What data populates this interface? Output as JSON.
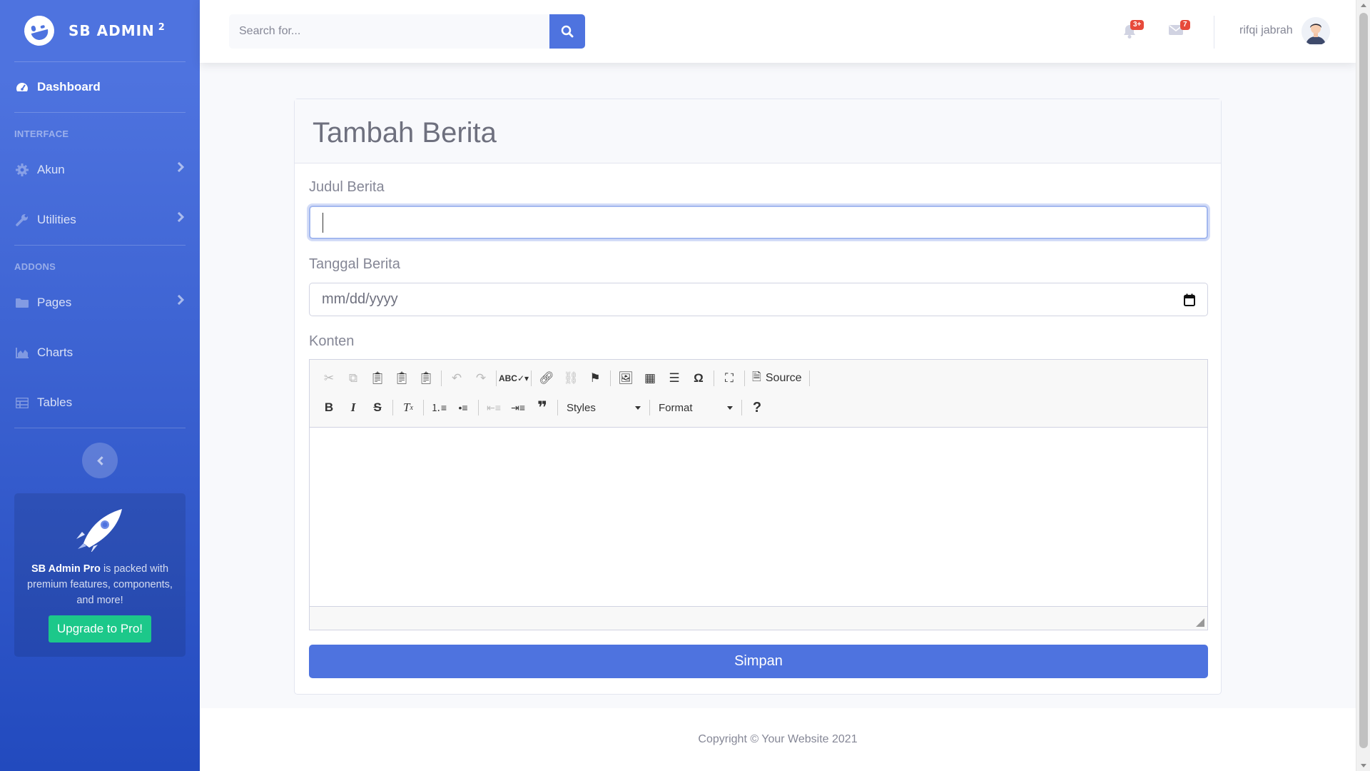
{
  "brand": {
    "name": "SB ADMIN",
    "sup": "2"
  },
  "sidebar": {
    "dashboard": "Dashboard",
    "heading_interface": "INTERFACE",
    "heading_addons": "ADDONS",
    "items": [
      {
        "label": "Akun",
        "icon": "gear-icon"
      },
      {
        "label": "Utilities",
        "icon": "wrench-icon"
      },
      {
        "label": "Pages",
        "icon": "folder-icon"
      },
      {
        "label": "Charts",
        "icon": "chart-area-icon"
      },
      {
        "label": "Tables",
        "icon": "table-icon"
      }
    ],
    "promo": {
      "strong": "SB Admin Pro",
      "text": " is packed with premium features, components, and more!",
      "button": "Upgrade to Pro!"
    }
  },
  "topbar": {
    "search_placeholder": "Search for...",
    "alerts_badge": "3+",
    "messages_badge": "7",
    "username": "rifqi jabrah"
  },
  "form": {
    "title": "Tambah Berita",
    "judul_label": "Judul Berita",
    "judul_value": "",
    "tanggal_label": "Tanggal Berita",
    "tanggal_placeholder": "mm/dd/yyyy",
    "konten_label": "Konten",
    "styles_label": "Styles",
    "format_label": "Format",
    "source_label": "Source",
    "submit_label": "Simpan"
  },
  "footer": {
    "copyright": "Copyright © Your Website 2021"
  },
  "colors": {
    "primary": "#4e73df",
    "success": "#1cc88a",
    "danger": "#e74a3b",
    "text": "#858796"
  }
}
